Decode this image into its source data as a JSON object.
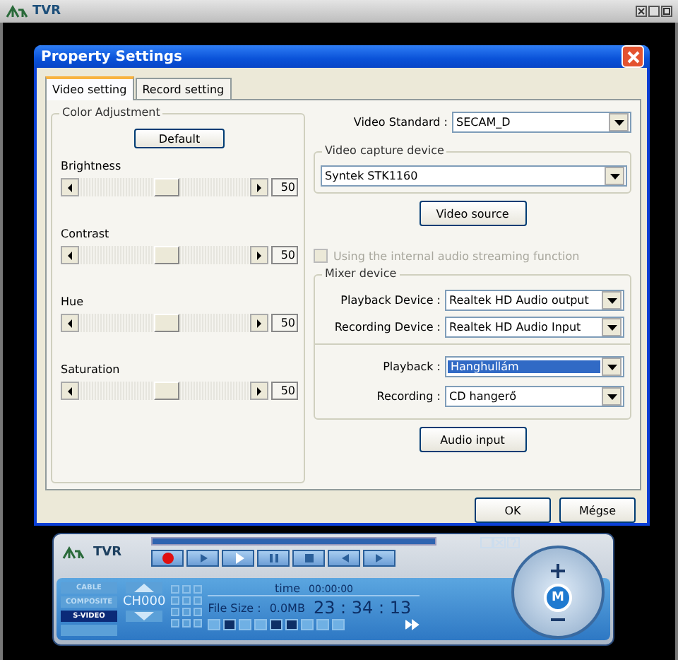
{
  "app_window": {
    "title": "TVR"
  },
  "dialog": {
    "title": "Property Settings",
    "tabs": [
      {
        "label": "Video setting",
        "selected": true
      },
      {
        "label": "Record setting",
        "selected": false
      }
    ],
    "color_adjustment": {
      "title": "Color Adjustment",
      "default_button": "Default",
      "sliders": [
        {
          "label": "Brightness",
          "level": 0.5,
          "reading": "50"
        },
        {
          "label": "Contrast",
          "level": 0.5,
          "reading": "50"
        },
        {
          "label": "Hue",
          "level": 0.5,
          "reading": "50"
        },
        {
          "label": "Saturation",
          "level": 0.5,
          "reading": "50"
        }
      ]
    },
    "video_standard": {
      "label": "Video Standard :",
      "value": "SECAM_D"
    },
    "video_capture_device": {
      "title": "Video capture device",
      "value": "Syntek STK1160",
      "button": "Video source"
    },
    "audio_streaming_checkbox": {
      "label": "Using the internal audio streaming function",
      "checked": false,
      "disabled": true
    },
    "mixer_device": {
      "title": "Mixer device",
      "devices": [
        {
          "label": "Playback Device :",
          "value": "Realtek HD Audio output",
          "selected": false
        },
        {
          "label": "Recording Device :",
          "value": "Realtek HD Audio Input",
          "selected": false
        }
      ],
      "lines": [
        {
          "label": "Playback :",
          "value": "Hanghullám",
          "selected": true
        },
        {
          "label": "Recording :",
          "value": "CD hangerő",
          "selected": false
        }
      ]
    },
    "audio_input_button": "Audio input",
    "buttons": [
      "OK",
      "Mégse"
    ]
  },
  "player": {
    "logo": "TVR",
    "progress": {
      "level": 1
    },
    "sources": [
      {
        "label": "CABLE",
        "selected": false
      },
      {
        "label": "COMPOSITE",
        "selected": false
      },
      {
        "label": "S-VIDEO",
        "selected": true
      },
      {
        "selected": false
      }
    ],
    "channel": "CH000",
    "time_label": "time",
    "time": "00:00:00",
    "file_size_label": "File Size :",
    "file_size": "0.0MB",
    "clock": "23 : 34 : 13",
    "volume_button": "M"
  }
}
